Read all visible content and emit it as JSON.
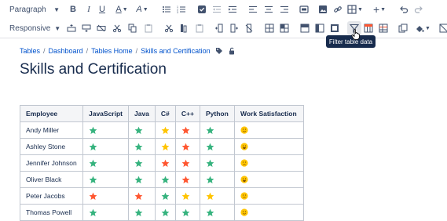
{
  "toolbar": {
    "paragraph_label": "Paragraph",
    "responsive_label": "Responsive",
    "tooltip": "Filter table data"
  },
  "breadcrumb": {
    "items": [
      "Tables",
      "Dashboard",
      "Tables Home",
      "Skills and Certification"
    ]
  },
  "page": {
    "title": "Skills and Certification"
  },
  "table": {
    "headers": [
      "Employee",
      "JavaScript",
      "Java",
      "C#",
      "C++",
      "Python",
      "Work Satisfaction"
    ],
    "rows": [
      {
        "employee": "Andy Miller",
        "javascript": "green",
        "java": "green",
        "csharp": "yellow",
        "cpp": "red",
        "python": "green",
        "satisfaction": "happy"
      },
      {
        "employee": "Ashley Stone",
        "javascript": "green",
        "java": "green",
        "csharp": "yellow",
        "cpp": "red",
        "python": "green",
        "satisfaction": "grin"
      },
      {
        "employee": "Jennifer Johnson",
        "javascript": "green",
        "java": "green",
        "csharp": "red",
        "cpp": "red",
        "python": "green",
        "satisfaction": "sad"
      },
      {
        "employee": "Oliver Black",
        "javascript": "green",
        "java": "green",
        "csharp": "green",
        "cpp": "red",
        "python": "green",
        "satisfaction": "grin"
      },
      {
        "employee": "Peter Jacobs",
        "javascript": "red",
        "java": "red",
        "csharp": "green",
        "cpp": "yellow",
        "python": "yellow",
        "satisfaction": "neutral"
      },
      {
        "employee": "Thomas Powell",
        "javascript": "green",
        "java": "green",
        "csharp": "green",
        "cpp": "green",
        "python": "green",
        "satisfaction": "happy"
      }
    ]
  },
  "colors": {
    "star_green": "#36b37e",
    "star_yellow": "#ffc400",
    "star_red": "#ff5630",
    "emoji_face": "#ffc400",
    "link": "#0052cc"
  }
}
